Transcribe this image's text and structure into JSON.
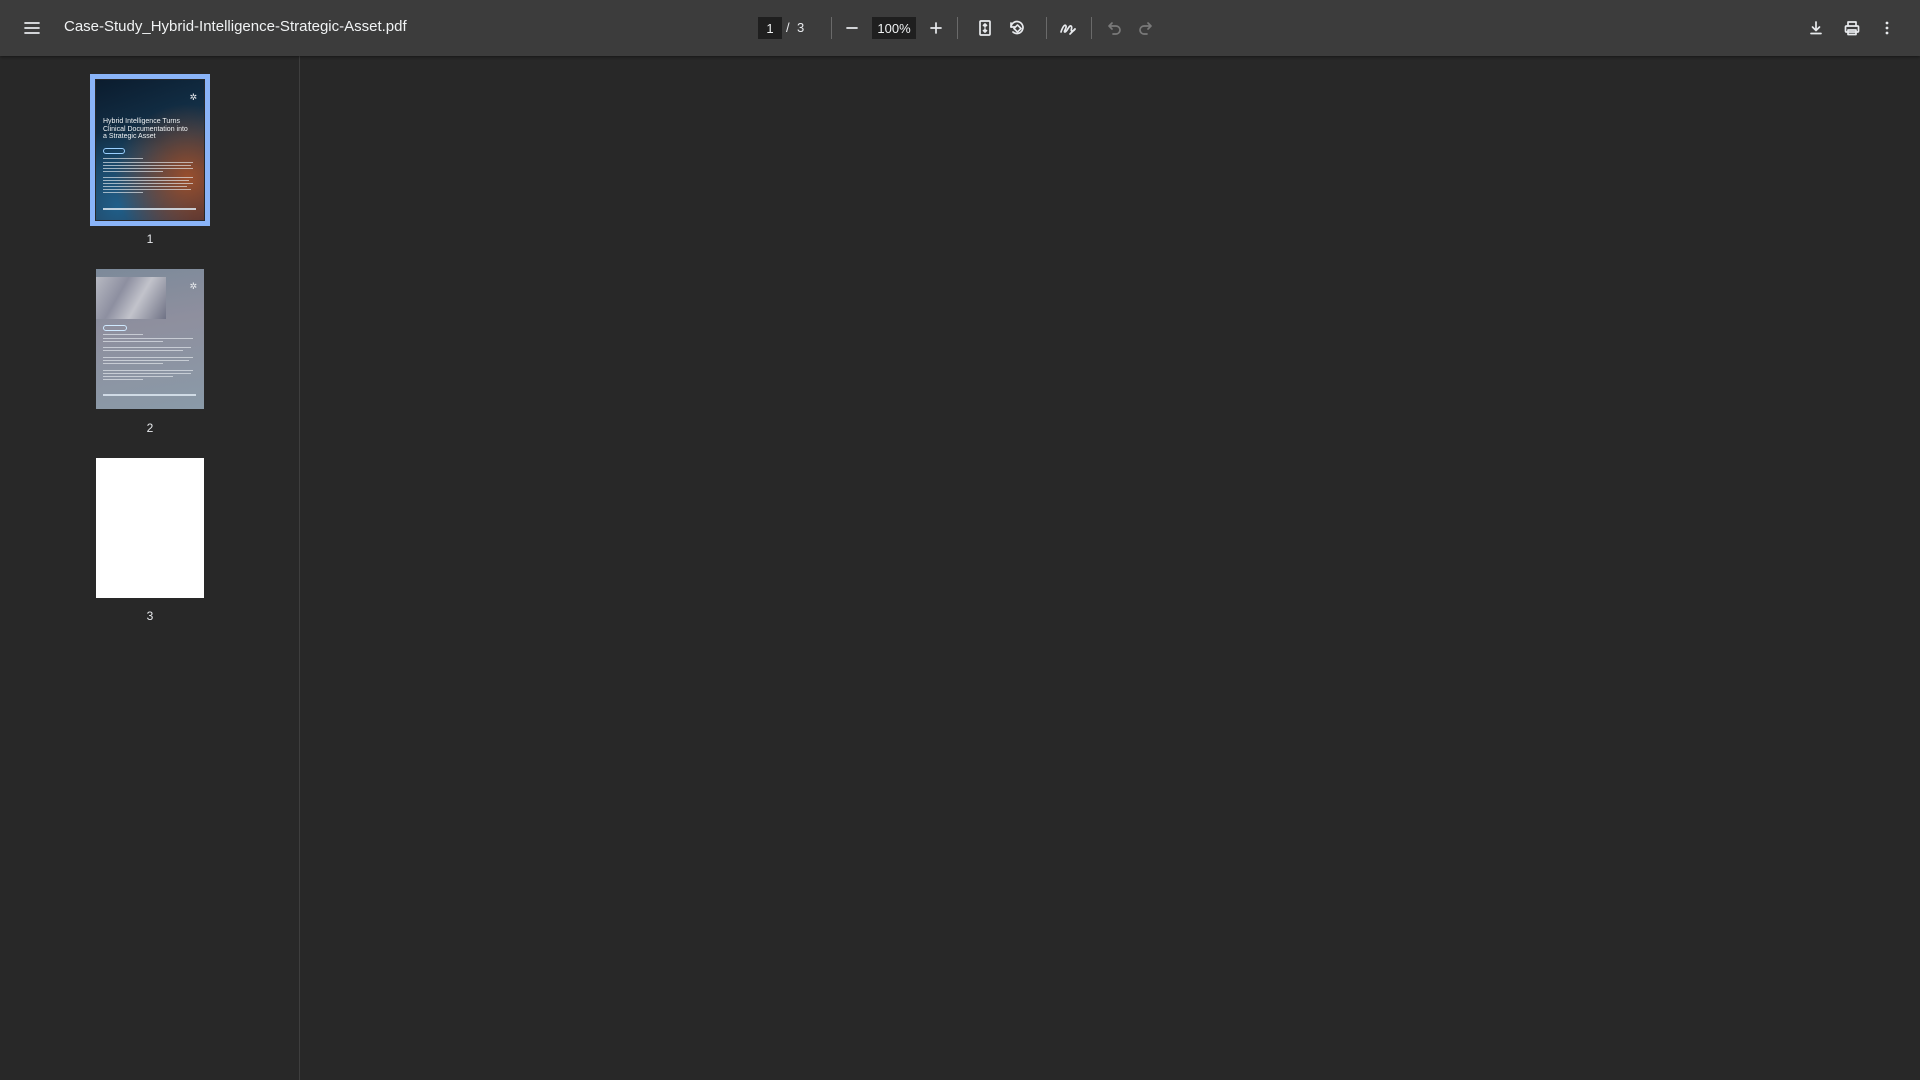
{
  "toolbar": {
    "menu_icon": "hamburger-menu-icon",
    "title": "Case-Study_Hybrid-Intelligence-Strategic-Asset.pdf",
    "page_current": "1",
    "page_separator": "/",
    "page_total": "3",
    "zoom_value": "100%",
    "icons": {
      "zoom_out": "minus-icon",
      "zoom_in": "plus-icon",
      "fit": "fit-page-icon",
      "rotate": "rotate-icon",
      "annotate": "draw-icon",
      "undo": "undo-icon",
      "redo": "redo-icon",
      "download": "download-icon",
      "print": "print-icon",
      "more": "more-vert-icon"
    }
  },
  "sidebar": {
    "thumbnails": [
      {
        "number": "1",
        "heading": "Hybrid Intelligence Turns Clinical Documentation into a Strategic Asset",
        "selected": true
      },
      {
        "number": "2",
        "selected": false
      },
      {
        "number": "3",
        "selected": false
      }
    ]
  },
  "colors": {
    "toolbar_bg": "#3c3c3c",
    "viewer_bg": "#282828",
    "selection_outline": "#8ab4f8"
  }
}
